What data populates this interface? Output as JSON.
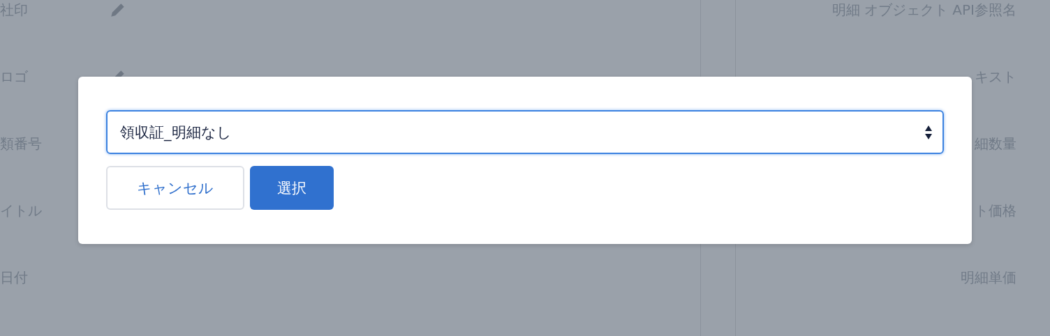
{
  "background": {
    "left_labels": [
      {
        "label": "社印",
        "editable": true
      },
      {
        "label": "ロゴ",
        "editable": true
      },
      {
        "label": "類番号",
        "editable": false
      },
      {
        "label": "イトル",
        "editable": false
      },
      {
        "label": "日付",
        "editable": false
      }
    ],
    "right_labels": [
      "明細 オブジェクト API参照名",
      "キスト",
      "細数量",
      "ト価格",
      "明細単価"
    ]
  },
  "dialog": {
    "select": {
      "value": "領収証_明細なし"
    },
    "buttons": [
      {
        "label": "キャンセル",
        "kind": "secondary"
      },
      {
        "label": "選択",
        "kind": "primary"
      }
    ]
  }
}
